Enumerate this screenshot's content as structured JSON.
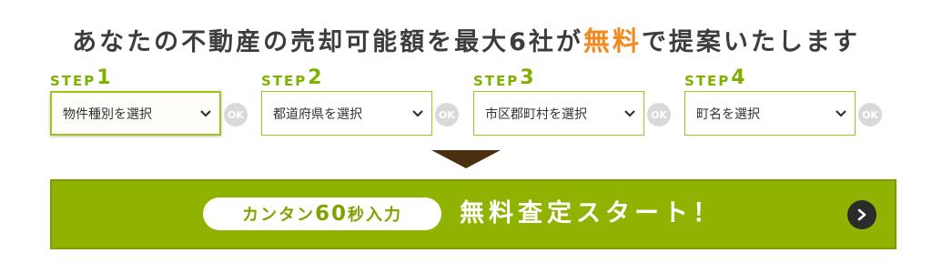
{
  "headline": {
    "before": "あなたの不動産の売却可能額を最大6社が",
    "highlight": "無料",
    "after": "で提案いたします"
  },
  "steps": [
    {
      "word": "STEP",
      "num": "1",
      "select_label": "物件種別を選択",
      "ok": "OK"
    },
    {
      "word": "STEP",
      "num": "2",
      "select_label": "都道府県を選択",
      "ok": "OK"
    },
    {
      "word": "STEP",
      "num": "3",
      "select_label": "市区郡町村を選択",
      "ok": "OK"
    },
    {
      "word": "STEP",
      "num": "4",
      "select_label": "町名を選択",
      "ok": "OK"
    }
  ],
  "cta": {
    "pill_prefix": "カンタン",
    "pill_number": "60",
    "pill_suffix": "秒入力",
    "title": "無料査定スタート！"
  },
  "colors": {
    "accent_green": "#8fb300",
    "step_green": "#7fb000",
    "highlight_orange": "#f08a1f",
    "arrow_brown": "#4a300d",
    "ok_gray": "#d9d9d9"
  },
  "icons": {
    "select_chevron": "chevron-down-icon",
    "cta_arrow": "chevron-right-icon",
    "divider_arrow": "triangle-down-icon"
  }
}
